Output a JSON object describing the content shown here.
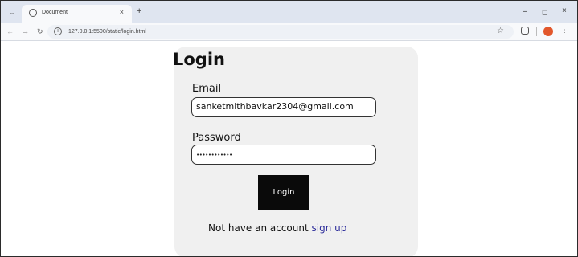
{
  "browser": {
    "tab_title": "Document",
    "tab_close": "×",
    "new_tab": "+",
    "url": "127.0.0.1:5500/static/login.html",
    "window_controls": {
      "minimize": "–",
      "maximize": "◻",
      "close": "×"
    },
    "icons": [
      "tab-search-icon",
      "globe-icon",
      "back-arrow-icon",
      "forward-arrow-icon",
      "reload-icon",
      "info-icon",
      "star-icon",
      "extensions-icon",
      "profile-icon",
      "kebab-menu-icon"
    ]
  },
  "login": {
    "heading": "Login",
    "email_label": "Email",
    "email_value": "sanketmithbavkar2304@gmail.com",
    "password_label": "Password",
    "password_value": "••••••••••••",
    "button_label": "Login",
    "signup_prompt": "Not have an account",
    "signup_link": "sign up"
  },
  "colors": {
    "card_bg": "#f0f0f0",
    "button_bg": "#0a0a0a",
    "link": "#2b2b9a",
    "profile": "#e2572b"
  }
}
